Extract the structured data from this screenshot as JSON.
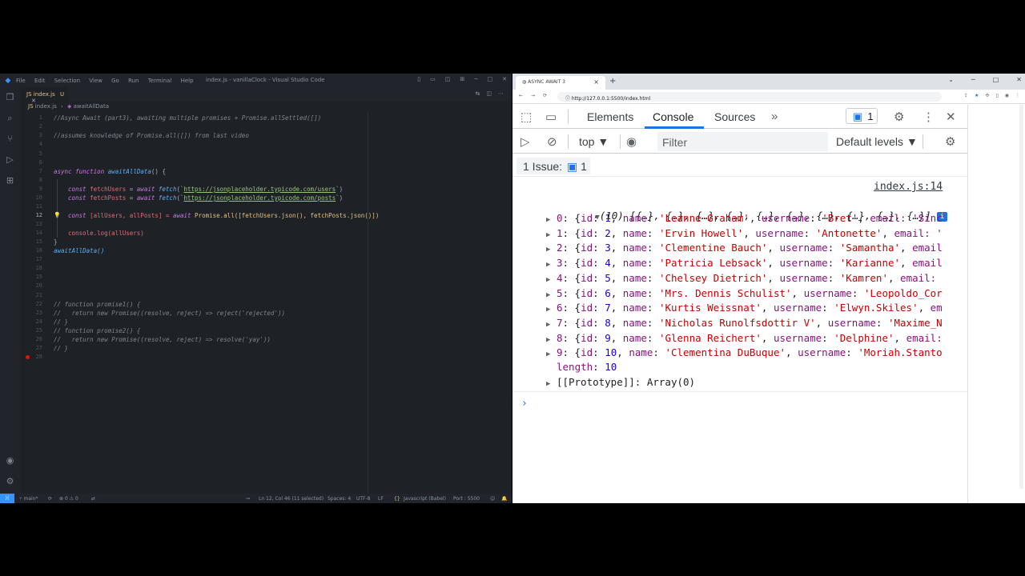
{
  "vscode": {
    "title": "index.js - vanillaClock - Visual Studio Code",
    "menu": [
      "File",
      "Edit",
      "Selection",
      "View",
      "Go",
      "Run",
      "Terminal",
      "Help"
    ],
    "tab": {
      "label": "index.js",
      "status": "U"
    },
    "breadcrumb": {
      "file": "index.js",
      "symbol": "awaitAllData"
    },
    "line_numbers": [
      "1",
      "2",
      "3",
      "4",
      "5",
      "6",
      "7",
      "8",
      "9",
      "10",
      "11",
      "12",
      "13",
      "14",
      "15",
      "16",
      "17",
      "18",
      "19",
      "20",
      "21",
      "22",
      "23",
      "24",
      "25",
      "26",
      "27",
      "28"
    ],
    "active_line": "12",
    "code": {
      "l1": "//Async Await (part3), awaiting multiple promises + Promise.allSettled([])",
      "l3": "//assumes knowledge of Promise.all([]) from last video",
      "l6_kw": "async function",
      "l6_fn": "awaitAllData",
      "l6_rest": "() {",
      "l8_a": "const",
      "l8_var": "fetchUsers",
      "l8_b": " = ",
      "l8_kw": "await",
      "l8_fn": "fetch",
      "l8_p1": "(`",
      "l8_url": "https://jsonplaceholder.typicode.com/users",
      "l8_p2": "`)",
      "l9_a": "const",
      "l9_var": "fetchPosts",
      "l9_b": " = ",
      "l9_kw": "await",
      "l9_fn": "fetch",
      "l9_p1": "(`",
      "l9_url": "https://jsonplaceholder.typicode.com/posts",
      "l9_p2": "`)",
      "l11_a": "const",
      "l11_b": " [allUsers, allPosts] = ",
      "l11_kw": "await",
      "l11_c": " Promise.all([fetchUsers.json(), fetchPosts.json()])",
      "l13": "console.log(allUsers)",
      "l14": "}",
      "l15": "awaitAllData()",
      "l20": "// function promise1() {",
      "l21": "//   return new Promise((resolve, reject) => reject('rejected'))",
      "l22": "// }",
      "l23": "// function promise2() {",
      "l24": "//   return new Promise((resolve, reject) => resolve('yay'))",
      "l25": "// }"
    },
    "status": {
      "branch": "main*",
      "errors": "0",
      "warnings": "0",
      "position": "Ln 12, Col 46 (11 selected)",
      "spaces": "Spaces: 4",
      "encoding": "UTF-8",
      "eol": "LF",
      "language": "Javascript (Babel)",
      "port": "Port : 5500"
    }
  },
  "browser": {
    "tab_title": "ASYNC AWAIT 3",
    "url": "http://127.0.0.1:5500/index.html",
    "devtools": {
      "tabs": [
        "Elements",
        "Console",
        "Sources"
      ],
      "active_tab": "Console",
      "issue_count": "1",
      "context": "top",
      "filter_placeholder": "Filter",
      "levels": "Default levels",
      "issues_label": "1 Issue:",
      "issues_count": "1"
    },
    "console": {
      "source": "index.js:14",
      "summary_count": "(10)",
      "summary_items": " [{…}, {…}, {…}, {…}, {…}, {…}, {…}, {…}, {…}, {…}]",
      "rows": [
        {
          "idx": "0",
          "id": "1",
          "name": "'Leanne Graham'",
          "username": "'Bret'",
          "tail": "email: 'Sinc"
        },
        {
          "idx": "1",
          "id": "2",
          "name": "'Ervin Howell'",
          "username": "'Antonette'",
          "tail": "email: '"
        },
        {
          "idx": "2",
          "id": "3",
          "name": "'Clementine Bauch'",
          "username": "'Samantha'",
          "tail": "email"
        },
        {
          "idx": "3",
          "id": "4",
          "name": "'Patricia Lebsack'",
          "username": "'Karianne'",
          "tail": "email"
        },
        {
          "idx": "4",
          "id": "5",
          "name": "'Chelsey Dietrich'",
          "username": "'Kamren'",
          "tail": "email:"
        },
        {
          "idx": "5",
          "id": "6",
          "name": "'Mrs. Dennis Schulist'",
          "username": "'Leopoldo_Cor",
          "tail": ""
        },
        {
          "idx": "6",
          "id": "7",
          "name": "'Kurtis Weissnat'",
          "username": "'Elwyn.Skiles'",
          "tail": "em"
        },
        {
          "idx": "7",
          "id": "8",
          "name": "'Nicholas Runolfsdottir V'",
          "username": "'Maxime_N",
          "tail": ""
        },
        {
          "idx": "8",
          "id": "9",
          "name": "'Glenna Reichert'",
          "username": "'Delphine'",
          "tail": "email:"
        },
        {
          "idx": "9",
          "id": "10",
          "name": "'Clementina DuBuque'",
          "username": "'Moriah.Stanto",
          "tail": ""
        }
      ],
      "length_key": "length",
      "length_val": "10",
      "proto_key": "[[Prototype]]",
      "proto_val": "Array(0)"
    }
  }
}
